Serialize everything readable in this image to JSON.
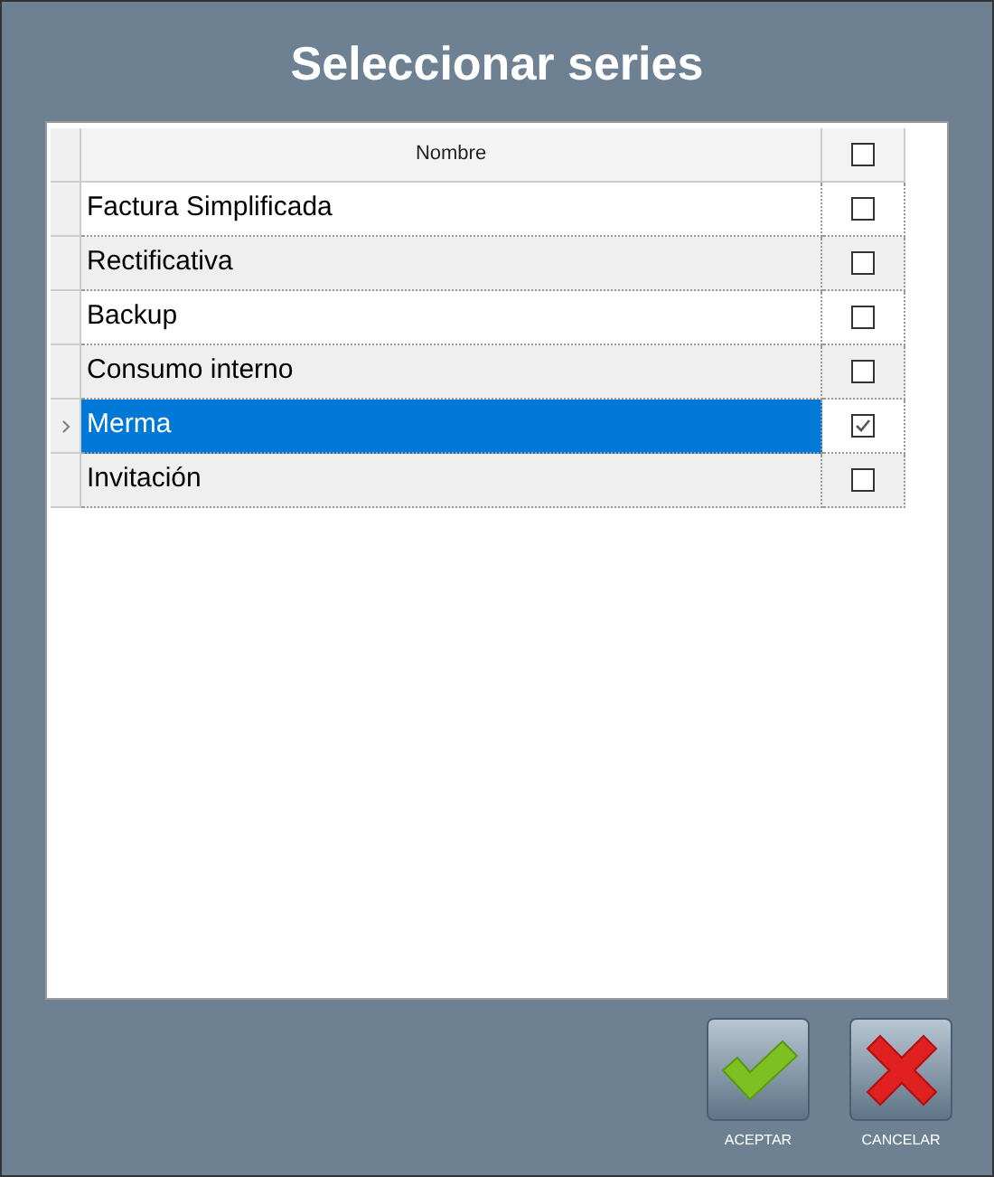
{
  "window": {
    "title": "Seleccionar series"
  },
  "table": {
    "columns": [
      {
        "label": "Nombre"
      },
      {
        "kind": "checkbox",
        "checked": false
      }
    ],
    "rows": [
      {
        "name": "Factura Simplificada",
        "checked": false,
        "selected": false
      },
      {
        "name": "Rectificativa",
        "checked": false,
        "selected": false
      },
      {
        "name": "Backup",
        "checked": false,
        "selected": false
      },
      {
        "name": "Consumo interno",
        "checked": false,
        "selected": false
      },
      {
        "name": "Merma",
        "checked": true,
        "selected": true
      },
      {
        "name": "Invitación",
        "checked": false,
        "selected": false
      }
    ]
  },
  "buttons": [
    {
      "kind": "accept",
      "label": "ACEPTAR"
    },
    {
      "kind": "cancel",
      "label": "CANCELAR"
    }
  ]
}
